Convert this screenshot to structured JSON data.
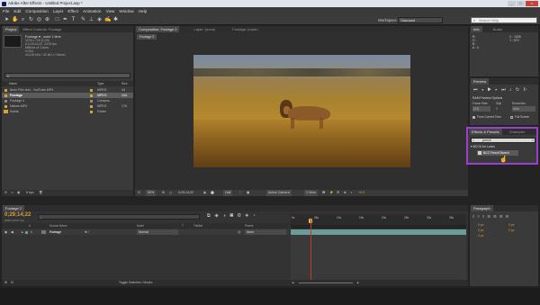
{
  "window": {
    "title": "Adobe After Effects - Untitled Project.aep *",
    "controls": [
      "_",
      "□",
      "×"
    ]
  },
  "menu": [
    "File",
    "Edit",
    "Composition",
    "Layer",
    "Effect",
    "Animation",
    "View",
    "Window",
    "Help"
  ],
  "toolbar": {
    "workspace_label": "Workspace:",
    "workspace_value": "Standard",
    "search_placeholder": "Search Help"
  },
  "project": {
    "tabs": [
      "Project",
      "Effect Controls: Footage"
    ],
    "footage_name": "Footage ▾ , used 1 time",
    "footage_info": [
      "1276 x 720 (1.00)",
      "Δ 0;29;14;22, 24.00 fps",
      "Millions of Colors",
      "H.264",
      "44.100 kHz / 32 bit U / Stereo"
    ],
    "columns": [
      "Name",
      "Type",
      "Size"
    ],
    "items": [
      {
        "name": "8mm Film test - YouTube.MP4",
        "type": "MPEG",
        "size": "44 ",
        "color": "#d7a23a",
        "selected": false
      },
      {
        "name": "Footage",
        "type": "MPEG",
        "size": "144 ",
        "color": "#d7a23a",
        "selected": true
      },
      {
        "name": "Footage 2",
        "type": "Compos...",
        "size": "",
        "color": "#8c8c8c",
        "selected": false
      },
      {
        "name": "Nature.MP4",
        "type": "MPEG",
        "size": "176 ",
        "color": "#d7a23a",
        "selected": false
      },
      {
        "name": "Solids",
        "type": "Folder",
        "size": "",
        "color": "#d7a23a",
        "selected": false
      }
    ],
    "bpc": "8 bpc"
  },
  "composition": {
    "tabs": [
      "Composition: Footage 2",
      "Layer: (none)",
      "Footage: (none)"
    ],
    "subtab": "Footage 2",
    "footer": [
      "50%",
      "0;29;14;22",
      "Half",
      "Active Camera",
      "1 View",
      "+0.0"
    ]
  },
  "info": {
    "tabs": [
      "Info",
      "Audio"
    ],
    "r": "R :",
    "g": "G :",
    "b": "B :",
    "a": "A : 0",
    "x": "X : 1026",
    "y": "Y : 572"
  },
  "preview": {
    "tab": "Preview",
    "ram_options": "RAM Preview Options",
    "labels": [
      "Frame Rate",
      "Skip",
      "Resolution"
    ],
    "values": [
      "(24)",
      "0",
      "Auto"
    ],
    "from_current": "From Current Time",
    "full_screen": "Full Screen"
  },
  "effects": {
    "tabs": [
      "Effects & Presets",
      "Character"
    ],
    "search_value": "pencil",
    "category": "▾ BCC6 Art Looks",
    "item": "BCC Pencil Sketch"
  },
  "paragraph": {
    "tab": "Paragraph",
    "fields": [
      "0 px",
      "0 px",
      "0 px",
      "0 px",
      "0 px"
    ]
  },
  "timeline": {
    "tab": "Footage 2",
    "timecode": "0;29;14;22",
    "timecode_sub": "00000 (29.97 fps)",
    "columns": [
      "#",
      "Source Name",
      "Mode",
      "T",
      "TrkMat",
      "Parent"
    ],
    "layer": {
      "index": "1",
      "name": "Footage",
      "mode": "Normal",
      "parent": "None"
    },
    "ruler": [
      "0s",
      "05s",
      "10s",
      "15s",
      "20s",
      "25s",
      "30s",
      "35s"
    ],
    "bottom": "Toggle Switches / Modes"
  },
  "colors": {
    "accent_purple": "#9b3fd0",
    "label_gold": "#d7a23a",
    "track_teal": "#6a9c9a",
    "playhead": "#c53a2a"
  }
}
